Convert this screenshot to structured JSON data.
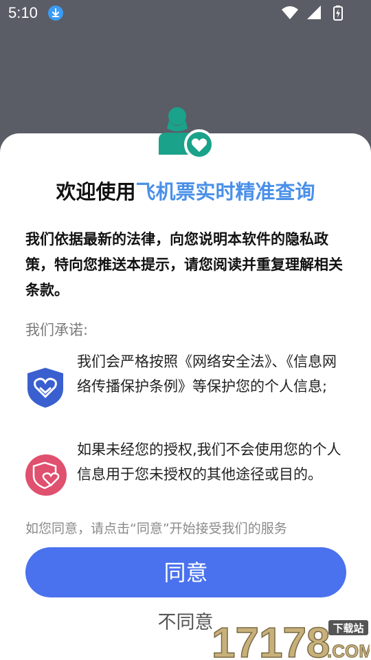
{
  "status_bar": {
    "time": "5:10",
    "icons": [
      "download-icon",
      "wifi-icon",
      "signal-icon",
      "battery-icon"
    ]
  },
  "dialog": {
    "title_prefix": "欢迎使用",
    "title_app": "飞机票实时精准查询",
    "intro": "我们依据最新的法律，向您说明本软件的隐私政策，特向您推送本提示，请您阅读并重复理解相关条款。",
    "promise_label": "我们承诺:",
    "promises": [
      {
        "icon": "shield-heart-icon",
        "text": "我们会严格按照《网络安全法》、《信息网络传播保护条例》等保护您的个人信息;"
      },
      {
        "icon": "heart-shield-circle-icon",
        "text": "如果未经您的授权,我们不会使用您的个人信息用于您未授权的其他途径或目的。"
      }
    ],
    "hint": "如您同意，请点击“同意”开始接受我们的服务",
    "agree_label": "同意",
    "disagree_label": "不同意"
  },
  "watermark": {
    "number": "17178",
    "site_tag": "下载站",
    "suffix": ".COM"
  },
  "colors": {
    "accent_blue": "#4a90e8",
    "button_blue": "#4a72ee",
    "teal": "#1aa28a",
    "shield_blue": "#3a5fcf",
    "pink": "#e0506f"
  }
}
